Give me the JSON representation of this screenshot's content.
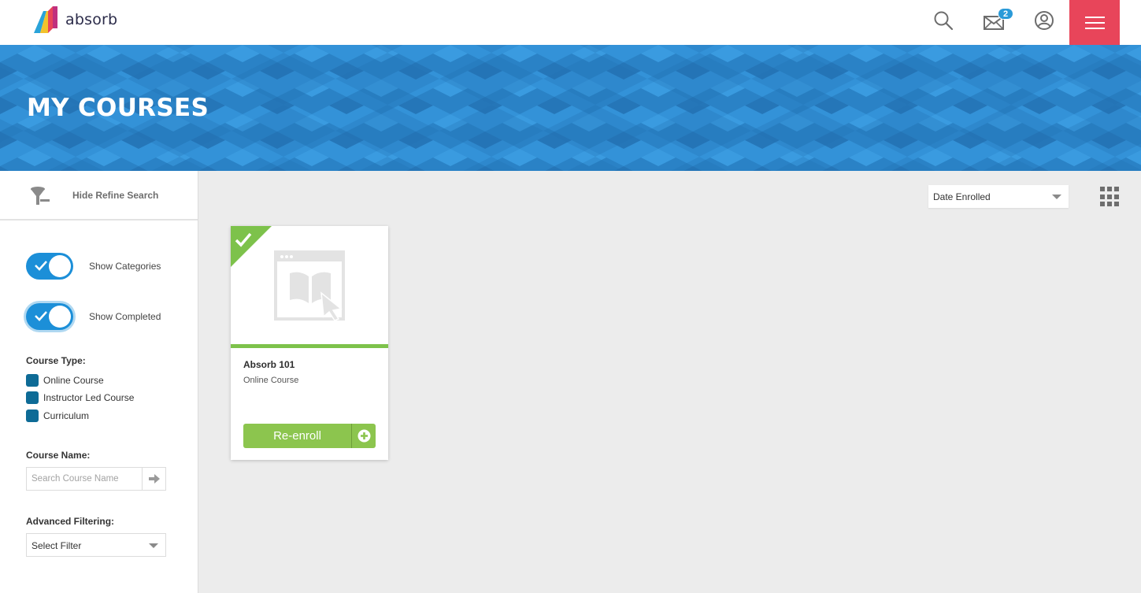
{
  "header": {
    "logo_text": "absorb",
    "icons": [
      "search-icon",
      "mail-icon",
      "user-account-icon",
      "hamburger-menu-icon"
    ],
    "mail_badge": "2",
    "menu_color": "#e8455a"
  },
  "banner": {
    "title": "MY COURSES",
    "color": "#2e8ed4"
  },
  "sidebar": {
    "refine_label": "Hide Refine Search",
    "toggles": [
      {
        "label": "Show Categories",
        "on": true
      },
      {
        "label": "Show Completed",
        "on": true
      }
    ],
    "course_type_label": "Course Type:",
    "course_types": [
      "Online Course",
      "Instructor Led Course",
      "Curriculum"
    ],
    "course_name_label": "Course Name:",
    "course_name_placeholder": "Search Course Name",
    "advanced_label": "Advanced Filtering:",
    "advanced_value": "Select Filter"
  },
  "main": {
    "sort_value": "Date Enrolled",
    "courses": [
      {
        "title": "Absorb 101",
        "type": "Online Course",
        "completed": true,
        "action_label": "Re-enroll",
        "progress_color": "#7dc24b"
      }
    ]
  }
}
